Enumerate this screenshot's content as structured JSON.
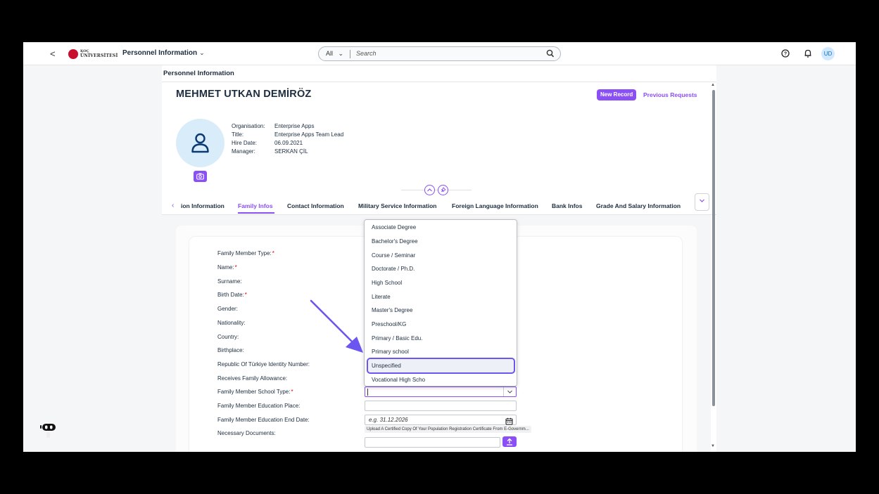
{
  "shell": {
    "back_glyph": "<",
    "logo_line1": "KOÇ",
    "logo_line2": "ÜNİVERSİTESİ",
    "app_title": "Personnel Information",
    "app_title_chevron": "⌄",
    "search_scope": "All",
    "search_scope_chevron": "⌄",
    "search_placeholder": "Search",
    "user_initials": "UD",
    "icons": [
      "back-icon",
      "help-icon",
      "bell-icon",
      "search-icon"
    ]
  },
  "page": {
    "breadcrumb": "Personnel Information",
    "employee_name": "MEHMET UTKAN DEMİRÖZ",
    "new_record": "New Record",
    "previous_requests": "Previous Requests",
    "info": [
      {
        "label": "Organisation:",
        "value": "Enterprise Apps"
      },
      {
        "label": "Title:",
        "value": "Enterprise Apps Team Lead"
      },
      {
        "label": "Hire Date:",
        "value": "06.09.2021"
      },
      {
        "label": "Manager:",
        "value": "SERKAN ÇİL"
      }
    ]
  },
  "tabs": [
    {
      "label": "ion Information"
    },
    {
      "label": "Family Infos",
      "active": true
    },
    {
      "label": "Contact Information"
    },
    {
      "label": "Military Service Information"
    },
    {
      "label": "Foreign Language Information"
    },
    {
      "label": "Bank Infos"
    },
    {
      "label": "Grade And Salary Information"
    }
  ],
  "form": {
    "fields": [
      {
        "label": "Family Member Type:",
        "required": "*"
      },
      {
        "label": "Name:",
        "required": "*"
      },
      {
        "label": "Surname:"
      },
      {
        "label": "Birth Date:",
        "required": "*"
      },
      {
        "label": "Gender:"
      },
      {
        "label": "Nationality:"
      },
      {
        "label": "Country:"
      },
      {
        "label": "Birthplace:"
      },
      {
        "label": "Republic Of Türkiye Identity Number:"
      },
      {
        "label": "Receives Family Allowance:"
      },
      {
        "label": "Family Member School Type:",
        "required": "*"
      },
      {
        "label": "Family Member Education Place:"
      },
      {
        "label": "Family Member Education End Date:"
      },
      {
        "label": "Necessary Documents:"
      }
    ],
    "end_date_placeholder": "e.g. 31.12.2026",
    "upload_note": "Upload A Certified Copy Of Your Population Registration Certificate From E-Governm..."
  },
  "dropdown": {
    "options": [
      "Associate Degree",
      "Bachelor's Degree",
      "Course / Seminar",
      "Doctorate / Ph.D.",
      "High School",
      "Literate",
      "Master's Degree",
      "Preschool/KG",
      "Primary / Basic Edu.",
      "Primary school",
      "Unspecified",
      "Vocational High Scho"
    ],
    "highlighted": "Unspecified"
  },
  "colors": {
    "accent": "#8a4ff5",
    "arrow": "#6b56f0",
    "required": "#dd0000"
  }
}
